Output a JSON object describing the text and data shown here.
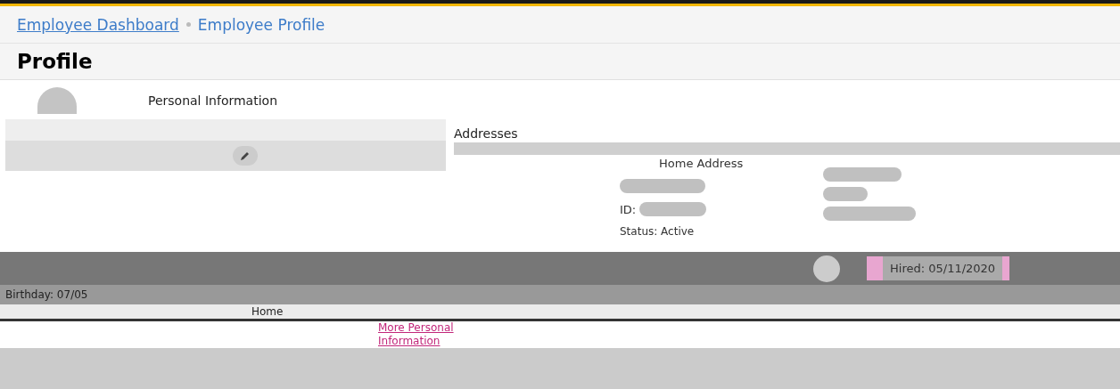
{
  "breadcrumb": [
    {
      "label": "Employee Dashboard",
      "current": false
    },
    {
      "label": "Employee Profile",
      "current": true
    }
  ],
  "page_title": "Profile",
  "personal_information": {
    "title": "Personal Information"
  },
  "addresses": {
    "title": "Addresses",
    "card_title": "Home Address"
  },
  "employee": {
    "id_label": "ID:",
    "status_label": "Status:",
    "status_value": "Active",
    "hired": "Hired: 05/11/2020",
    "birthday": "Birthday: 07/05"
  },
  "home_tab": "Home",
  "more_link": "More Personal Information"
}
